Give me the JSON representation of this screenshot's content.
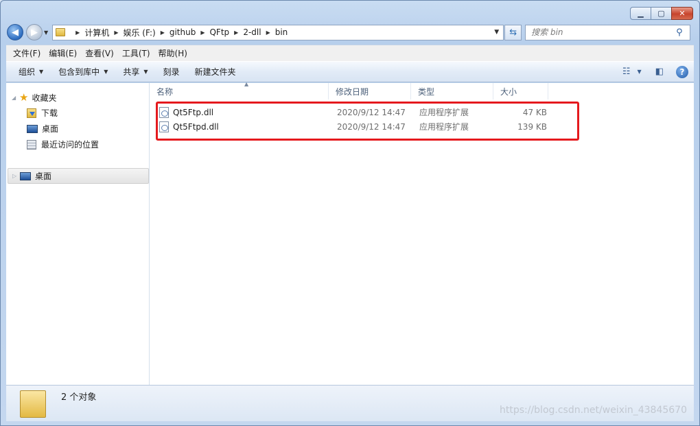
{
  "window": {
    "min_label": "▁",
    "max_label": "▢",
    "close_label": "✕"
  },
  "nav": {
    "back_label": "◀",
    "forward_label": "▶",
    "breadcrumb": [
      "计算机",
      "娱乐 (F:)",
      "github",
      "QFtp",
      "2-dll",
      "bin"
    ],
    "search_placeholder": "搜索 bin"
  },
  "menubar": [
    "文件(F)",
    "编辑(E)",
    "查看(V)",
    "工具(T)",
    "帮助(H)"
  ],
  "toolbar": {
    "organize": "组织",
    "include_library": "包含到库中",
    "share": "共享",
    "burn": "刻录",
    "new_folder": "新建文件夹"
  },
  "sidebar": {
    "favorites": "收藏夹",
    "items": [
      "下载",
      "桌面",
      "最近访问的位置"
    ],
    "desktop_node": "桌面"
  },
  "columns": [
    "名称",
    "修改日期",
    "类型",
    "大小"
  ],
  "files": [
    {
      "name": "Qt5Ftp.dll",
      "modified": "2020/9/12 14:47",
      "type": "应用程序扩展",
      "size": "47 KB"
    },
    {
      "name": "Qt5Ftpd.dll",
      "modified": "2020/9/12 14:47",
      "type": "应用程序扩展",
      "size": "139 KB"
    }
  ],
  "status": {
    "count": "2 个对象"
  },
  "watermark": "https://blog.csdn.net/weixin_43845670",
  "colors": {
    "highlight": "#e5191d",
    "accent": "#2f6fb5"
  }
}
